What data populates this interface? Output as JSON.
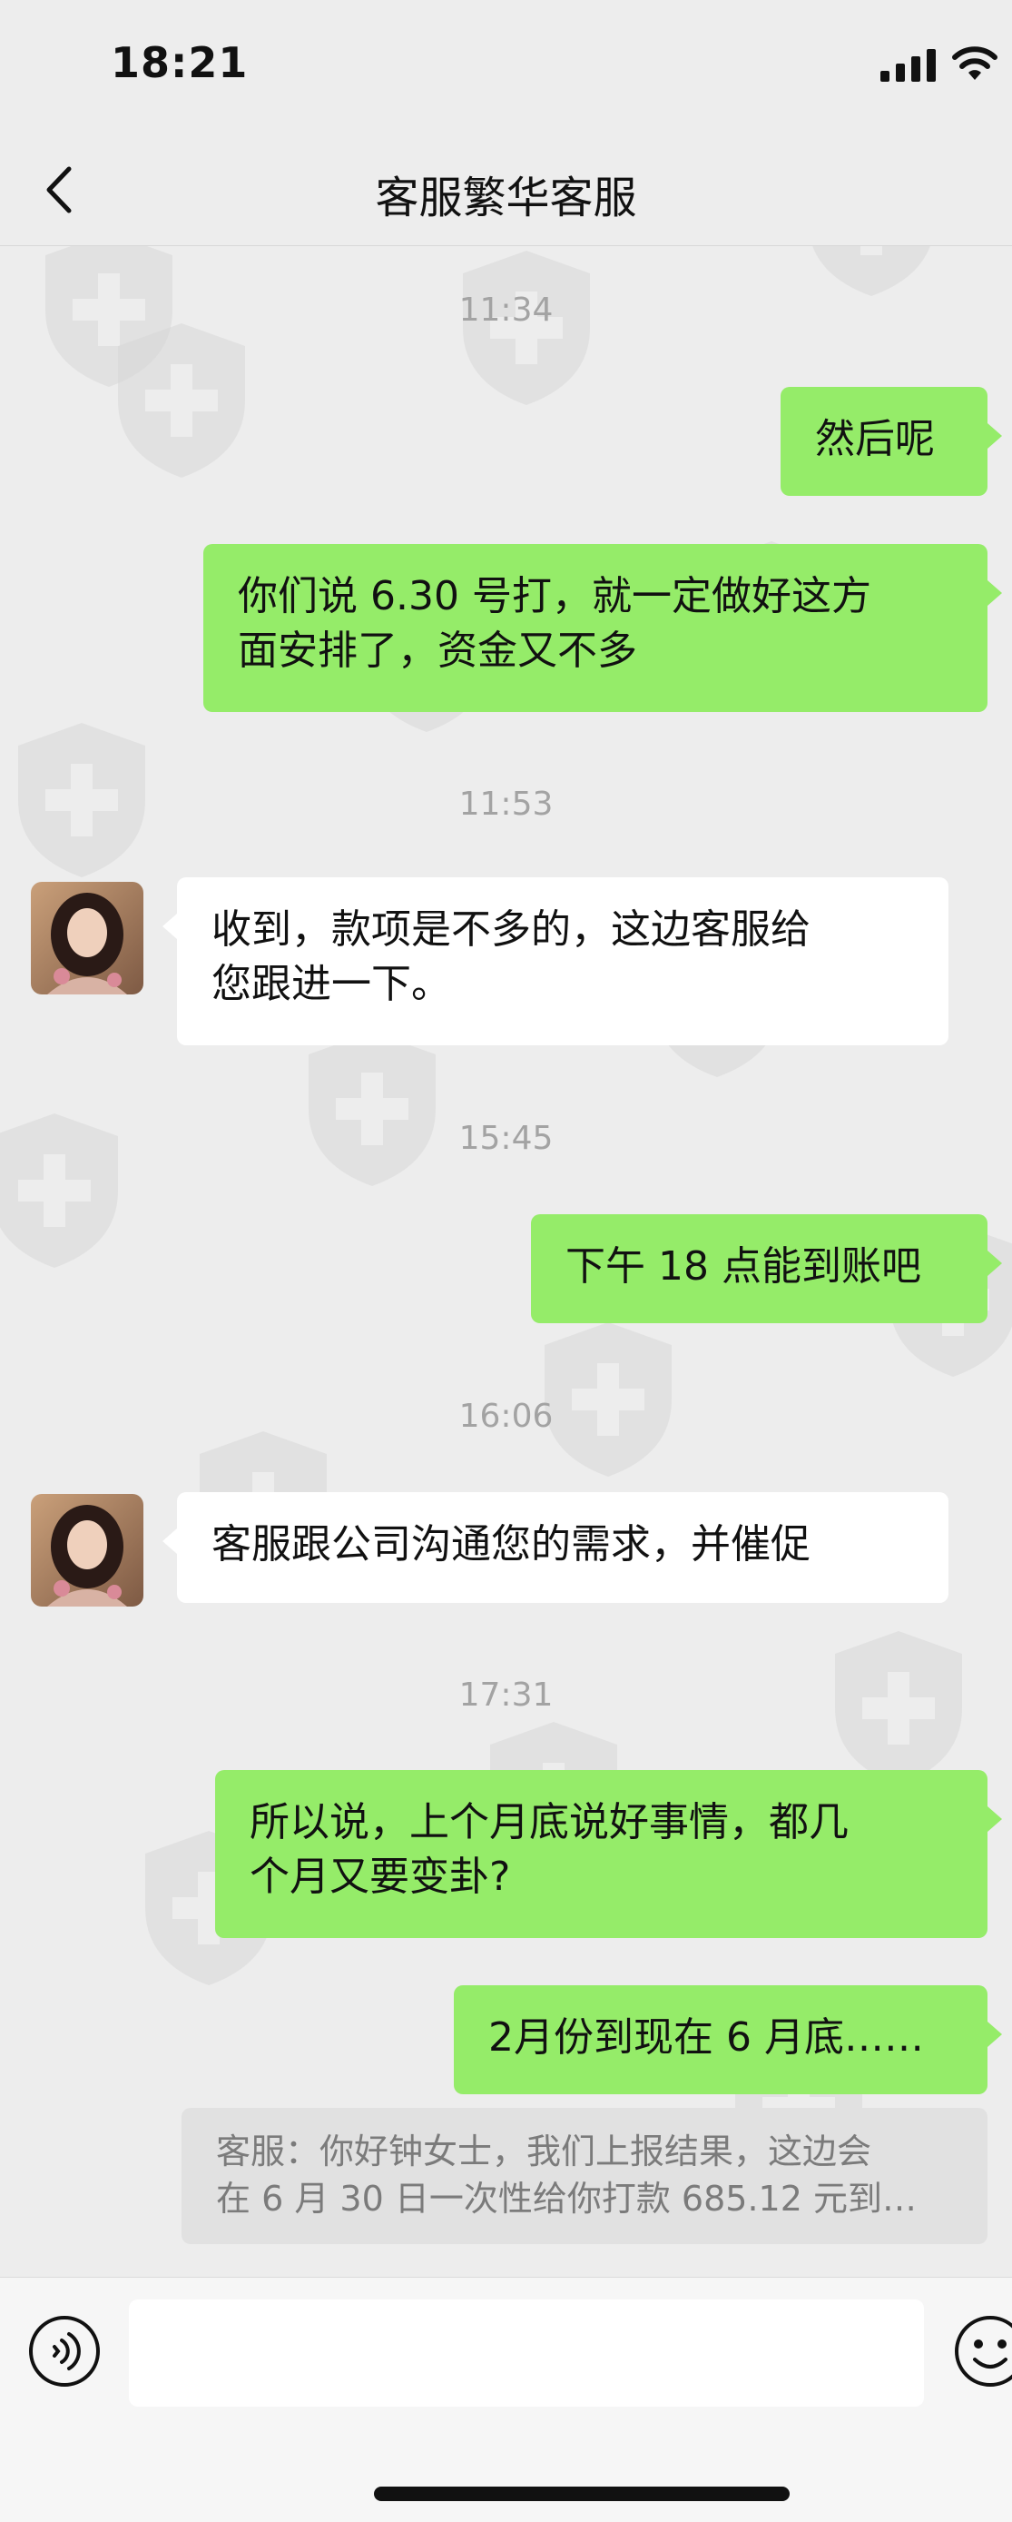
{
  "status_bar": {
    "time": "18:21"
  },
  "nav": {
    "title": "客服繁华客服"
  },
  "messages": [
    {
      "type": "timestamp",
      "text": "11:34"
    },
    {
      "type": "outgoing",
      "text": "然后呢"
    },
    {
      "type": "outgoing",
      "lines": [
        "你们说 6.30 号打，就一定做好这方",
        "面安排了，资金又不多"
      ]
    },
    {
      "type": "timestamp",
      "text": "11:53"
    },
    {
      "type": "incoming",
      "lines": [
        "收到，款项是不多的，这边客服给",
        "您跟进一下。"
      ]
    },
    {
      "type": "timestamp",
      "text": "15:45"
    },
    {
      "type": "outgoing",
      "text": "下午 18 点能到账吧"
    },
    {
      "type": "timestamp",
      "text": "16:06"
    },
    {
      "type": "incoming",
      "text": "客服跟公司沟通您的需求，并催促"
    },
    {
      "type": "timestamp",
      "text": "17:31"
    },
    {
      "type": "outgoing",
      "lines": [
        "所以说，上个月底说好事情，都几",
        "个月又要变卦?"
      ]
    },
    {
      "type": "outgoing",
      "text": "2月份到现在 6 月底……"
    }
  ],
  "quote": {
    "lines": [
      "客服：你好钟女士，我们上报结果，这边会",
      "在 6 月 30 日一次性给你打款 685.12 元到…"
    ]
  },
  "input": {
    "value": "",
    "placeholder": ""
  },
  "icons": {
    "back": "chevron-left-icon",
    "voice": "voice-icon",
    "emoji": "emoji-icon",
    "signal": "cellular-signal-icon",
    "wifi": "wifi-icon",
    "watermark": "shield-cross-icon"
  },
  "colors": {
    "outgoing_bubble": "#95ec69",
    "incoming_bubble": "#ffffff",
    "background": "#ededed",
    "timestamp_text": "#a3a3a3"
  }
}
